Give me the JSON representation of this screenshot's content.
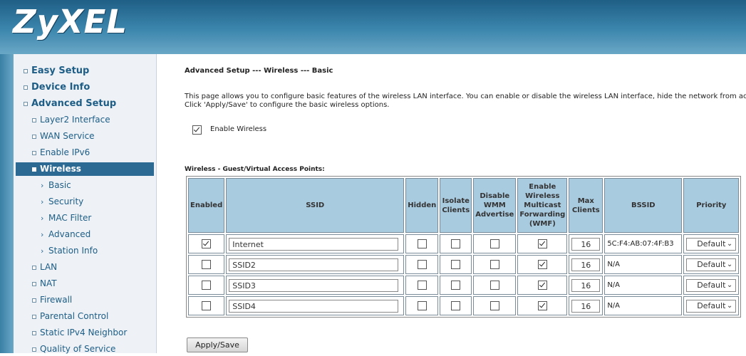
{
  "brand": {
    "logo_text": "ZyXEL"
  },
  "sidebar": {
    "items": [
      {
        "label": "Easy Setup",
        "level": 0
      },
      {
        "label": "Device Info",
        "level": 0
      },
      {
        "label": "Advanced Setup",
        "level": 0
      },
      {
        "label": "Layer2 Interface",
        "level": 1
      },
      {
        "label": "WAN Service",
        "level": 1
      },
      {
        "label": "Enable IPv6",
        "level": 1
      },
      {
        "label": "Wireless",
        "level": 1,
        "active": true
      },
      {
        "label": "Basic",
        "level": 2
      },
      {
        "label": "Security",
        "level": 2
      },
      {
        "label": "MAC Filter",
        "level": 2
      },
      {
        "label": "Advanced",
        "level": 2
      },
      {
        "label": "Station Info",
        "level": 2
      },
      {
        "label": "LAN",
        "level": 1
      },
      {
        "label": "NAT",
        "level": 1
      },
      {
        "label": "Firewall",
        "level": 1
      },
      {
        "label": "Parental Control",
        "level": 1
      },
      {
        "label": "Static IPv4 Neighbor",
        "level": 1
      },
      {
        "label": "Quality of Service",
        "level": 1
      }
    ]
  },
  "main": {
    "title": "Advanced Setup --- Wireless --- Basic",
    "description_line1": "This page allows you to configure basic features of the wireless LAN interface. You can enable or disable the wireless LAN interface, hide the network from act",
    "description_line2": "Click 'Apply/Save' to configure the basic wireless options.",
    "enable_wireless": {
      "label": "Enable Wireless",
      "checked": true
    },
    "section_label": "Wireless - Guest/Virtual Access Points:",
    "table": {
      "headers": {
        "enabled": "Enabled",
        "ssid": "SSID",
        "hidden": "Hidden",
        "isolate": "Isolate Clients",
        "disable_wmm": "Disable WMM Advertise",
        "wmf": "Enable Wireless Multicast Forwarding (WMF)",
        "max_clients": "Max Clients",
        "bssid": "BSSID",
        "priority": "Priority"
      },
      "rows": [
        {
          "enabled": true,
          "ssid": "Internet",
          "hidden": false,
          "isolate": false,
          "disable_wmm": false,
          "wmf": true,
          "max_clients": "16",
          "bssid": "5C:F4:AB:07:4F:B3",
          "priority": "Default"
        },
        {
          "enabled": false,
          "ssid": "SSID2",
          "hidden": false,
          "isolate": false,
          "disable_wmm": false,
          "wmf": true,
          "max_clients": "16",
          "bssid": "N/A",
          "priority": "Default"
        },
        {
          "enabled": false,
          "ssid": "SSID3",
          "hidden": false,
          "isolate": false,
          "disable_wmm": false,
          "wmf": true,
          "max_clients": "16",
          "bssid": "N/A",
          "priority": "Default"
        },
        {
          "enabled": false,
          "ssid": "SSID4",
          "hidden": false,
          "isolate": false,
          "disable_wmm": false,
          "wmf": true,
          "max_clients": "16",
          "bssid": "N/A",
          "priority": "Default"
        }
      ]
    },
    "apply_button": "Apply/Save"
  },
  "colors": {
    "header": "#3c86ad",
    "nav_text": "#1d5d86",
    "nav_active_bg": "#2c6a94",
    "table_header_bg": "#a9cbe0"
  },
  "icons": {
    "bullet": "square-bullet-icon",
    "sub_arrow": "chevron-right-icon",
    "select": "chevron-down-icon",
    "check": "checkmark-icon"
  }
}
